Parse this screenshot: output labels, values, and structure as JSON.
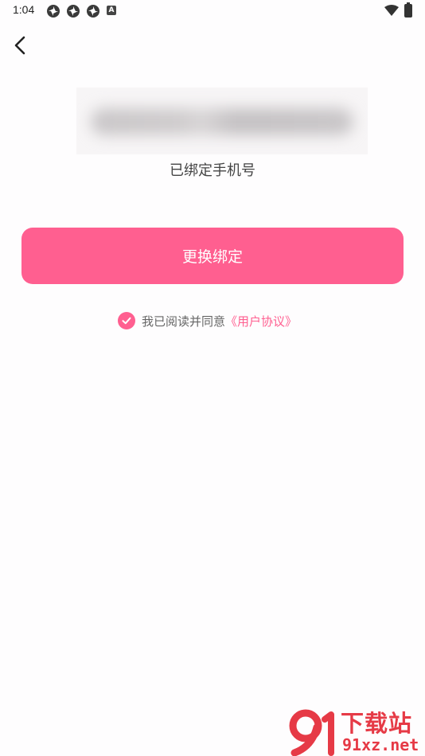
{
  "status_bar": {
    "time": "1:04",
    "notification_icons": [
      "aperture-icon",
      "aperture-icon",
      "aperture-icon"
    ],
    "a_badge": "A"
  },
  "nav": {
    "back_icon": "chevron-left-icon"
  },
  "phone": {
    "label": "已绑定手机号"
  },
  "actions": {
    "change_binding": "更换绑定"
  },
  "agreement": {
    "checked": true,
    "prefix": "我已阅读并同意",
    "link": "《用户协议》"
  },
  "watermark": {
    "logo_text": "91",
    "title": "下载站",
    "url": "91xz.net"
  },
  "colors": {
    "accent": "#ff5f90",
    "background": "#fefdfe",
    "watermark": "#e63a46"
  }
}
